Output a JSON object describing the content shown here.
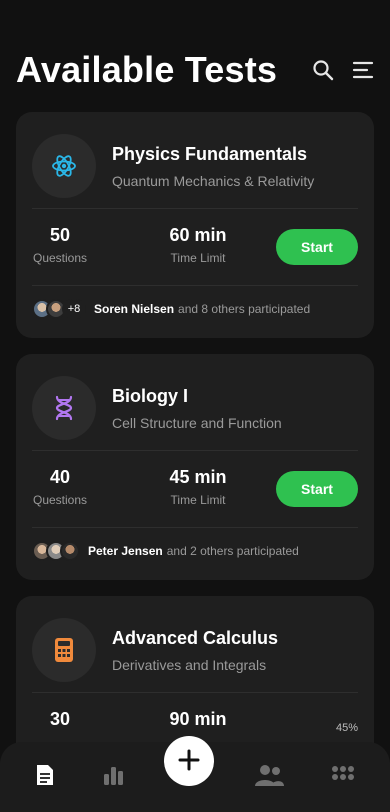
{
  "header": {
    "title": "Available Tests",
    "search_icon": "search-icon",
    "menu_icon": "menu-icon"
  },
  "tests": [
    {
      "title": "Physics Fundamentals",
      "subtitle": "Quantum Mechanics & Relativity",
      "icon": "atom-icon",
      "icon_color": "#2ab7e8",
      "questions": "50",
      "questions_label": "Questions",
      "time": "60 min",
      "time_label": "Time Limit",
      "start_label": "Start",
      "avatars_more": "+8",
      "participant_name": "Soren Nielsen",
      "participant_rest": "and 8 others participated"
    },
    {
      "title": "Biology I",
      "subtitle": "Cell Structure and Function",
      "icon": "dna-icon",
      "icon_color": "#b277f0",
      "questions": "40",
      "questions_label": "Questions",
      "time": "45 min",
      "time_label": "Time Limit",
      "start_label": "Start",
      "participant_name": "Peter Jensen",
      "participant_rest": "and 2 others participated"
    },
    {
      "title": "Advanced Calculus",
      "subtitle": "Derivatives and Integrals",
      "icon": "calculator-icon",
      "icon_color": "#f08a3c",
      "questions": "30",
      "time": "90 min",
      "progress_percent": 45,
      "progress_text": "45%"
    }
  ],
  "bottom_nav": {
    "items": [
      "document-icon",
      "bar-chart-icon",
      "plus-icon",
      "people-icon",
      "grid-icon"
    ],
    "active": "document-icon"
  },
  "colors": {
    "background": "#111111",
    "card": "#1f1f1f",
    "accent_green": "#2fc150",
    "muted_text": "#9a9a9a"
  }
}
